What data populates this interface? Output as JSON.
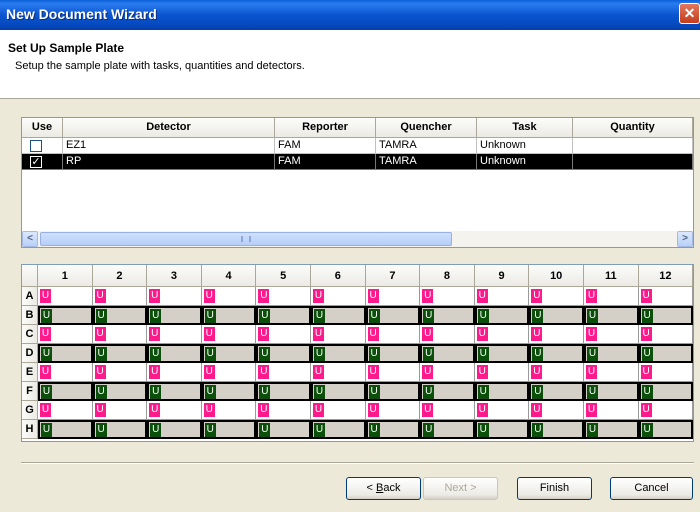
{
  "window": {
    "title": "New Document Wizard",
    "close_glyph": "✕"
  },
  "header": {
    "title": "Set Up Sample Plate",
    "subtitle": "Setup the sample plate with tasks, quantities and detectors."
  },
  "detector_table": {
    "columns": [
      "Use",
      "Detector",
      "Reporter",
      "Quencher",
      "Task",
      "Quantity"
    ],
    "rows": [
      {
        "checked": false,
        "detector": "EZ1",
        "reporter": "FAM",
        "quencher": "TAMRA",
        "task": "Unknown",
        "quantity": "",
        "selected": false
      },
      {
        "checked": true,
        "detector": "RP",
        "reporter": "FAM",
        "quencher": "TAMRA",
        "task": "Unknown",
        "quantity": "",
        "selected": true
      }
    ],
    "scroll_left": "<",
    "scroll_right": ">"
  },
  "plate": {
    "columns": [
      "1",
      "2",
      "3",
      "4",
      "5",
      "6",
      "7",
      "8",
      "9",
      "10",
      "11",
      "12"
    ],
    "rows": [
      "A",
      "B",
      "C",
      "D",
      "E",
      "F",
      "G",
      "H"
    ],
    "well_label": "U",
    "colors": {
      "pink": "#ff1a8c",
      "green": "#0b4f0b"
    }
  },
  "buttons": {
    "back_prefix": "< ",
    "back_hotkey": "B",
    "back_rest": "ack",
    "next": "Next >",
    "finish": "Finish",
    "cancel": "Cancel"
  }
}
